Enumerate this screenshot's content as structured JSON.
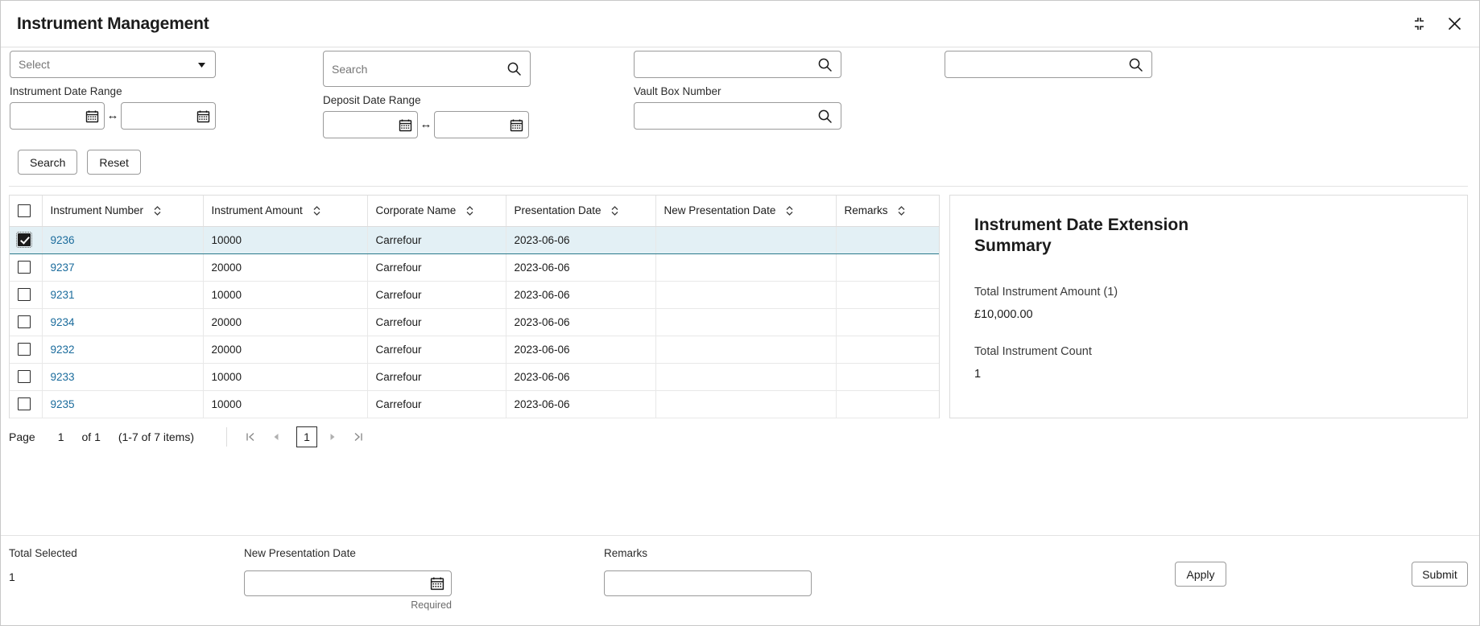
{
  "window": {
    "title": "Instrument Management",
    "restore_icon": "collapse-icon",
    "close_icon": "close-icon"
  },
  "filters": {
    "instrument_type": {
      "label": "",
      "placeholder": "Select",
      "value": "",
      "dropdown_icon": "chevron-down-icon"
    },
    "corporate_search": {
      "label": "",
      "placeholder": "Search",
      "value": "",
      "icon": "search-icon"
    },
    "field_three": {
      "label": "",
      "placeholder": "",
      "value": "",
      "icon": "search-icon"
    },
    "field_four": {
      "label": "",
      "placeholder": "",
      "value": "",
      "icon": "search-icon"
    },
    "instrument_date_range": {
      "label": "Instrument Date Range",
      "from_value": "",
      "to_value": "",
      "separator": "↔",
      "icon": "calendar-icon"
    },
    "deposit_date_range": {
      "label": "Deposit Date Range",
      "from_value": "",
      "to_value": "",
      "separator": "↔",
      "icon": "calendar-icon"
    },
    "vault_box_number": {
      "label": "Vault Box Number",
      "value": "",
      "placeholder": "",
      "icon": "search-icon"
    },
    "search_button": "Search",
    "reset_button": "Reset"
  },
  "table": {
    "select_all_checked": false,
    "columns": [
      {
        "key": "check",
        "label": "",
        "sortable": false
      },
      {
        "key": "instrument_number",
        "label": "Instrument Number",
        "sortable": true
      },
      {
        "key": "instrument_amount",
        "label": "Instrument Amount",
        "sortable": true
      },
      {
        "key": "corporate_name",
        "label": "Corporate Name",
        "sortable": true
      },
      {
        "key": "presentation_date",
        "label": "Presentation Date",
        "sortable": true
      },
      {
        "key": "new_presentation_date",
        "label": "New Presentation Date",
        "sortable": true
      },
      {
        "key": "remarks",
        "label": "Remarks",
        "sortable": true
      }
    ],
    "rows": [
      {
        "selected": true,
        "instrument_number": "9236",
        "instrument_amount": "10000",
        "corporate_name": "Carrefour",
        "presentation_date": "2023-06-06",
        "new_presentation_date": "",
        "remarks": ""
      },
      {
        "selected": false,
        "instrument_number": "9237",
        "instrument_amount": "20000",
        "corporate_name": "Carrefour",
        "presentation_date": "2023-06-06",
        "new_presentation_date": "",
        "remarks": ""
      },
      {
        "selected": false,
        "instrument_number": "9231",
        "instrument_amount": "10000",
        "corporate_name": "Carrefour",
        "presentation_date": "2023-06-06",
        "new_presentation_date": "",
        "remarks": ""
      },
      {
        "selected": false,
        "instrument_number": "9234",
        "instrument_amount": "20000",
        "corporate_name": "Carrefour",
        "presentation_date": "2023-06-06",
        "new_presentation_date": "",
        "remarks": ""
      },
      {
        "selected": false,
        "instrument_number": "9232",
        "instrument_amount": "20000",
        "corporate_name": "Carrefour",
        "presentation_date": "2023-06-06",
        "new_presentation_date": "",
        "remarks": ""
      },
      {
        "selected": false,
        "instrument_number": "9233",
        "instrument_amount": "10000",
        "corporate_name": "Carrefour",
        "presentation_date": "2023-06-06",
        "new_presentation_date": "",
        "remarks": ""
      },
      {
        "selected": false,
        "instrument_number": "9235",
        "instrument_amount": "10000",
        "corporate_name": "Carrefour",
        "presentation_date": "2023-06-06",
        "new_presentation_date": "",
        "remarks": ""
      }
    ]
  },
  "summary": {
    "heading": "Instrument Date Extension Summary",
    "total_amount_label": "Total Instrument Amount (1)",
    "total_amount_value": "£10,000.00",
    "total_count_label": "Total Instrument Count",
    "total_count_value": "1"
  },
  "pagination": {
    "page_label": "Page",
    "page_number": "1",
    "of_label": "of 1",
    "items_label": "(1-7 of 7 items)",
    "first_icon": "first-page-icon",
    "prev_icon": "previous-page-icon",
    "current_page": "1",
    "next_icon": "next-page-icon",
    "last_icon": "last-page-icon"
  },
  "footer": {
    "total_selected_label": "Total Selected",
    "total_selected_value": "1",
    "new_presentation_date_label": "New Presentation Date",
    "new_presentation_date_value": "",
    "new_presentation_date_hint": "Required",
    "new_presentation_date_icon": "calendar-icon",
    "remarks_label": "Remarks",
    "remarks_value": "",
    "apply_button": "Apply",
    "submit_button": "Submit"
  },
  "colors": {
    "link": "#1a6b9c",
    "selected_row_bg": "#e3f0f5",
    "selected_row_border": "#2b7a8c",
    "border": "#dcdcdc"
  }
}
